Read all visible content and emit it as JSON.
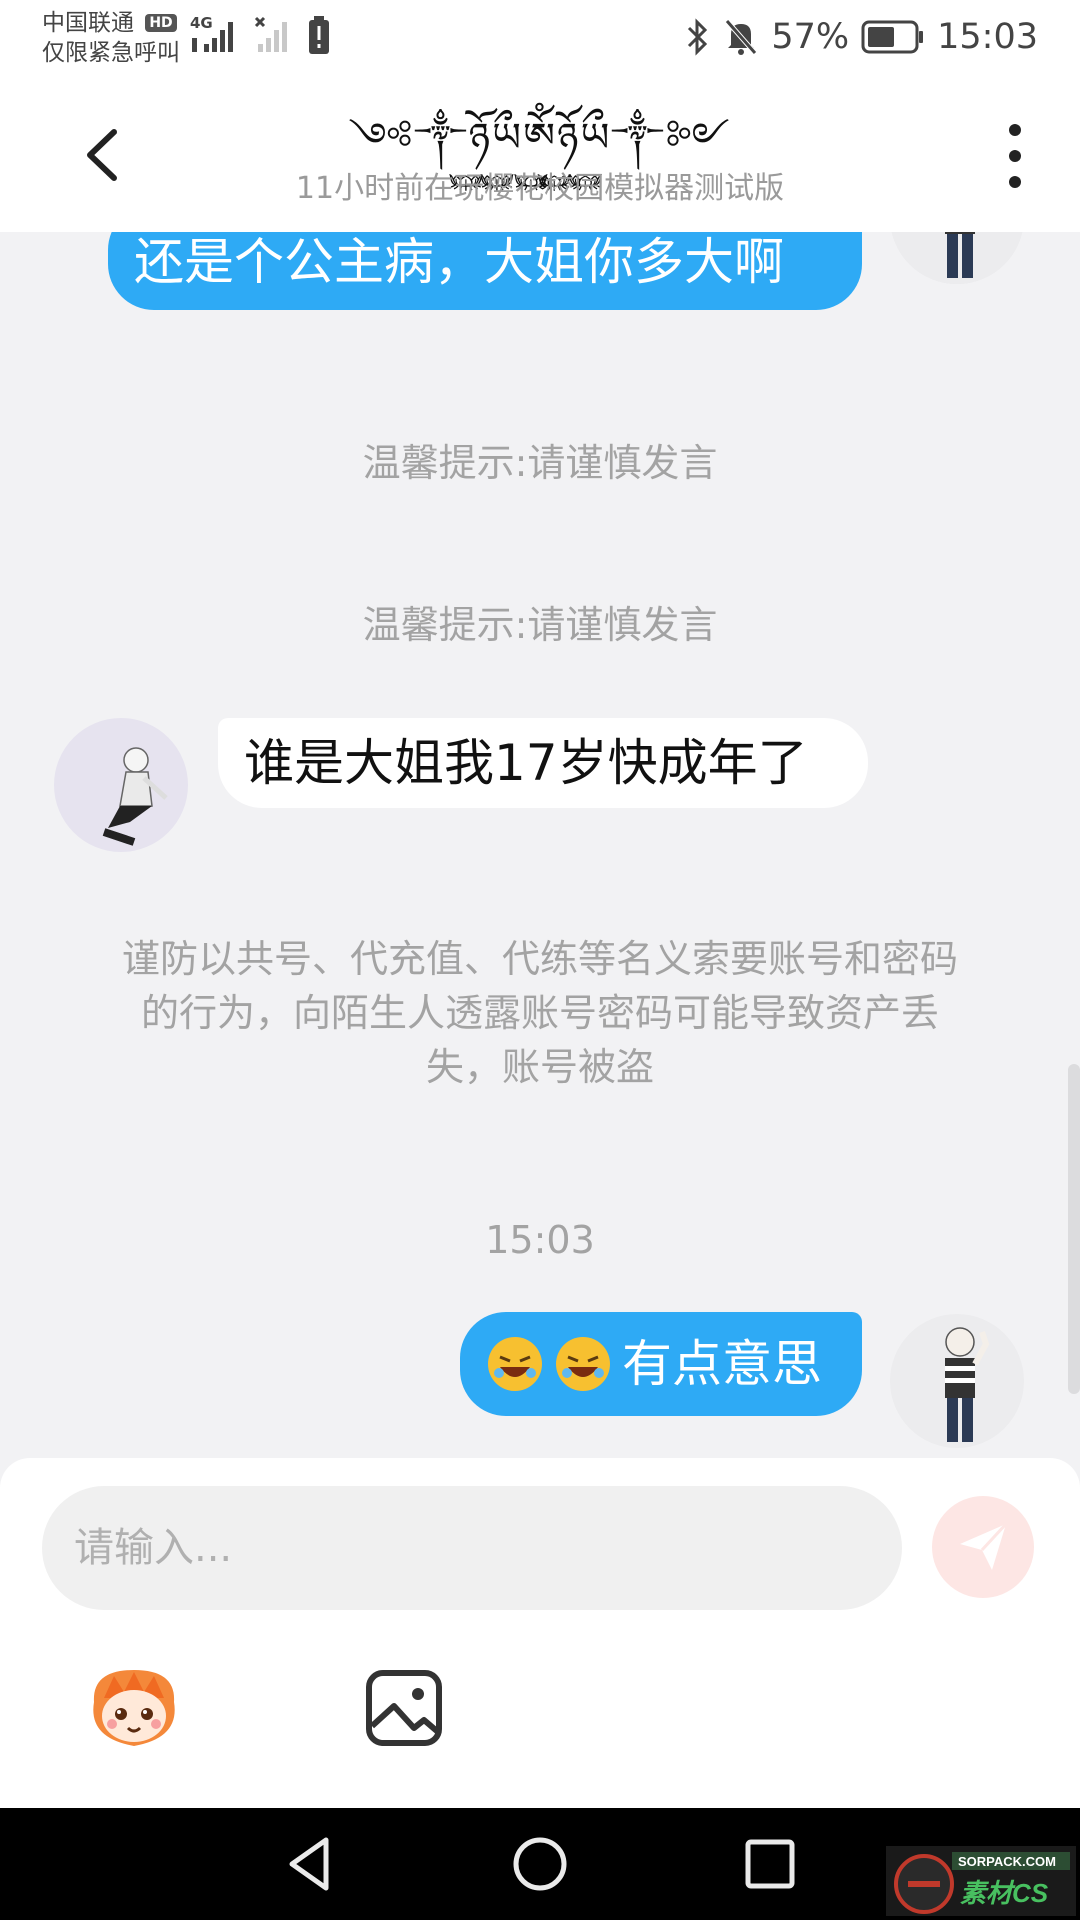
{
  "status_bar": {
    "carrier_line1": "中国联通",
    "hd_badge": "HD",
    "carrier_line2": "仅限紧急呼叫",
    "network_type": "4G",
    "battery_percent": "57%",
    "time": "15:03",
    "icons": [
      "signal-icon",
      "no-signal-icon",
      "battery-alert-icon",
      "bluetooth-icon",
      "mute-bell-icon",
      "battery-icon"
    ]
  },
  "header": {
    "title": "༺༒ཉོ࿆ཡྀ࿆ༀ࿆ཉོ࿆ཡྀ࿆༒༻",
    "subtitle": "11小时前在玩樱花校园模拟器测试版",
    "back_icon": "back-arrow-icon",
    "more_icon": "more-vertical-icon"
  },
  "messages": [
    {
      "side": "me",
      "text": "还是个公主病，大姐你多大啊"
    },
    {
      "type": "notice",
      "text": "温馨提示:请谨慎发言"
    },
    {
      "type": "notice",
      "text": "温馨提示:请谨慎发言"
    },
    {
      "side": "them",
      "text": "谁是大姐我17岁快成年了"
    },
    {
      "type": "notice",
      "text": "谨防以共号、代充值、代练等名义索要账号和密码的行为，向陌生人透露账号密码可能导致资产丢失，账号被盗"
    },
    {
      "type": "time",
      "text": "15:03"
    },
    {
      "side": "me",
      "emoji": [
        "rolling-laughing-emoji",
        "rolling-laughing-emoji"
      ],
      "text": "有点意思"
    }
  ],
  "input": {
    "placeholder": "请输入...",
    "value": "",
    "send_icon": "send-paper-plane-icon",
    "tools": [
      "sticker-icon",
      "image-icon"
    ]
  },
  "nav": {
    "buttons": [
      "back-triangle-icon",
      "home-circle-icon",
      "recents-square-icon"
    ]
  },
  "watermark": {
    "line1": "SORPACK.COM",
    "line2": "素材CS"
  },
  "colors": {
    "my_bubble": "#2eaaf5",
    "their_bubble": "#ffffff",
    "chat_bg": "#f2f2f4",
    "notice_text": "#a3a3a3",
    "send_button": "#fde6e4"
  }
}
